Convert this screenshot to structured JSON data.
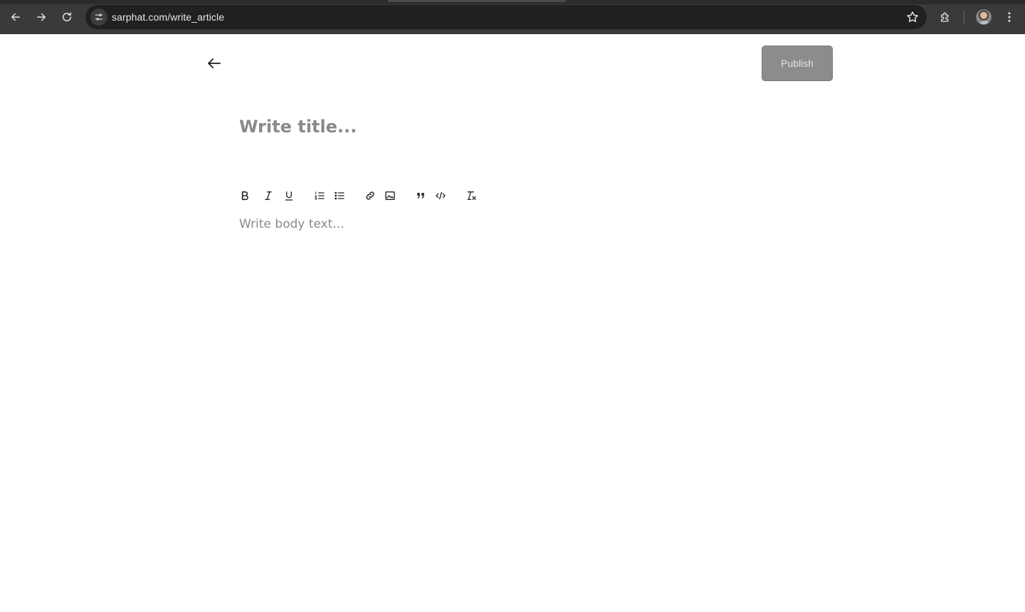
{
  "browser": {
    "url": "sarphat.com/write_article",
    "icons": {
      "back": "back-icon",
      "forward": "forward-icon",
      "reload": "reload-icon",
      "site_info": "tune-icon",
      "bookmark": "star-icon",
      "extensions": "puzzle-icon",
      "profile": "avatar",
      "menu": "more-vert-icon"
    }
  },
  "page": {
    "back_icon": "arrow-left-icon",
    "publish_label": "Publish",
    "title_placeholder": "Write title...",
    "body_placeholder": "Write body text...",
    "toolbar": [
      {
        "name": "bold",
        "icon": "bold-icon"
      },
      {
        "name": "italic",
        "icon": "italic-icon"
      },
      {
        "name": "underline",
        "icon": "underline-icon"
      },
      {
        "name": "ordered-list",
        "icon": "ordered-list-icon"
      },
      {
        "name": "bullet-list",
        "icon": "bullet-list-icon"
      },
      {
        "name": "link",
        "icon": "link-icon"
      },
      {
        "name": "image",
        "icon": "image-icon"
      },
      {
        "name": "blockquote",
        "icon": "quote-icon"
      },
      {
        "name": "code",
        "icon": "code-icon"
      },
      {
        "name": "clear-format",
        "icon": "clear-format-icon"
      }
    ],
    "colors": {
      "publish_bg": "#8c8c8c",
      "publish_text": "#e4e4e4",
      "placeholder": "#8a8a8a"
    }
  }
}
